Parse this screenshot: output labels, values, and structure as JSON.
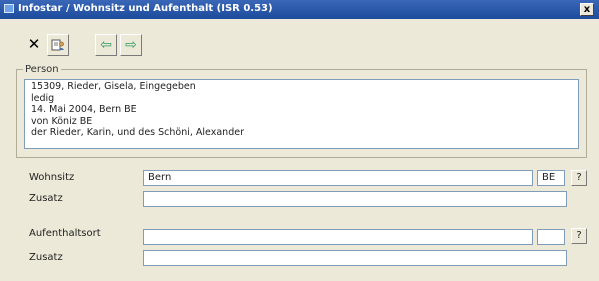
{
  "window": {
    "title": "Infostar / Wohnsitz und Aufenthalt (ISR 0.53)",
    "close_label": "x"
  },
  "toolbar": {
    "close_symbol": "✕",
    "prev_symbol": "⇦",
    "next_symbol": "⇨"
  },
  "person": {
    "legend": "Person",
    "lines": [
      "15309, Rieder, Gisela, Eingegeben",
      "ledig",
      "14. Mai 2004, Bern BE",
      "von Köniz BE",
      "der Rieder, Karin, und des Schöni, Alexander"
    ]
  },
  "wohnsitz": {
    "label": "Wohnsitz",
    "value": "Bern",
    "canton": "BE",
    "help": "?"
  },
  "zusatz1": {
    "label": "Zusatz",
    "value": ""
  },
  "aufenthalt": {
    "label": "Aufenthaltsort",
    "value": "",
    "canton": "",
    "help": "?"
  },
  "zusatz2": {
    "label": "Zusatz",
    "value": ""
  },
  "colors": {
    "titlebar": "#1d4b9c",
    "accent_green": "#2e9a64"
  }
}
